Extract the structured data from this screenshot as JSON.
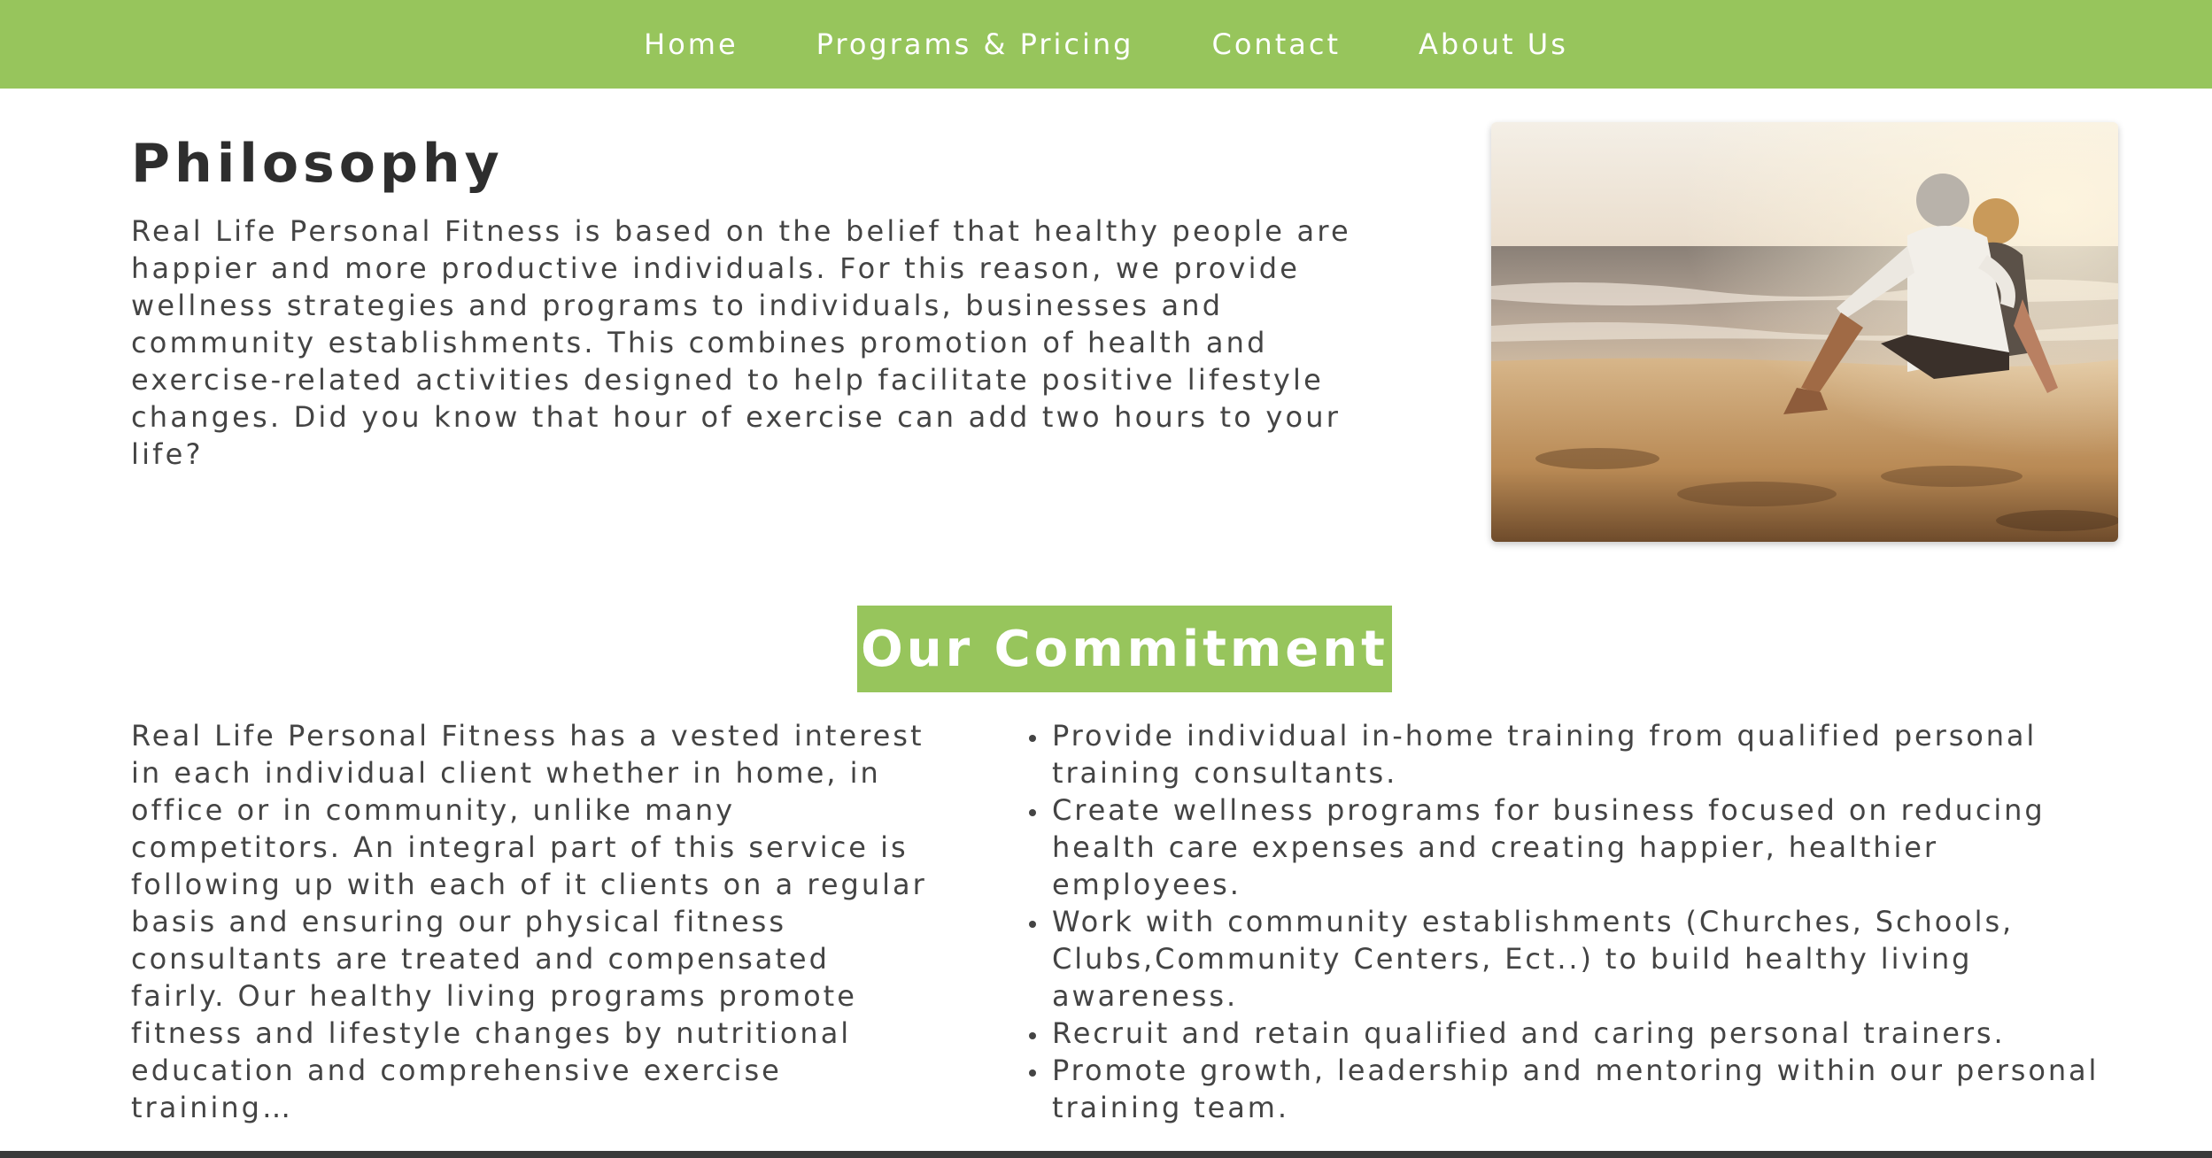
{
  "nav": {
    "items": [
      {
        "label": "Home"
      },
      {
        "label": "Programs & Pricing"
      },
      {
        "label": "Contact"
      },
      {
        "label": "About Us"
      }
    ]
  },
  "philosophy": {
    "title": "Philosophy",
    "body": "Real Life Personal Fitness is based on the belief that healthy people are happier and more productive individuals. For this reason, we provide wellness strategies and programs to individuals, businesses and community establishments. This combines promotion of health and exercise-related activities designed to help facilitate positive lifestyle changes. Did you know that hour of exercise can add two hours to your life?",
    "image": "beach-couple-photo"
  },
  "commitment": {
    "title": "Our Commitment",
    "body": "Real Life Personal Fitness has a vested interest in each individual client whether in home, in office or in community, unlike many competitors. An integral part of this service is following up with each of it clients on a regular basis and ensuring our physical fitness consultants are treated and compensated fairly. Our healthy living programs promote fitness and lifestyle changes by nutritional education and comprehensive exercise training…",
    "points": [
      "Provide individual in-home training from qualified personal training consultants.",
      "Create wellness programs for business focused on reducing health care expenses and creating happier, healthier employees.",
      "Work with community establishments (Churches, Schools, Clubs,Community Centers, Ect..) to build healthy living awareness.",
      "Recruit and retain qualified and caring personal trainers.",
      "Promote growth, leadership and mentoring within our personal training team."
    ]
  },
  "colors": {
    "accent": "#97c55c",
    "text": "#444444",
    "heading": "#2e2e2e"
  }
}
